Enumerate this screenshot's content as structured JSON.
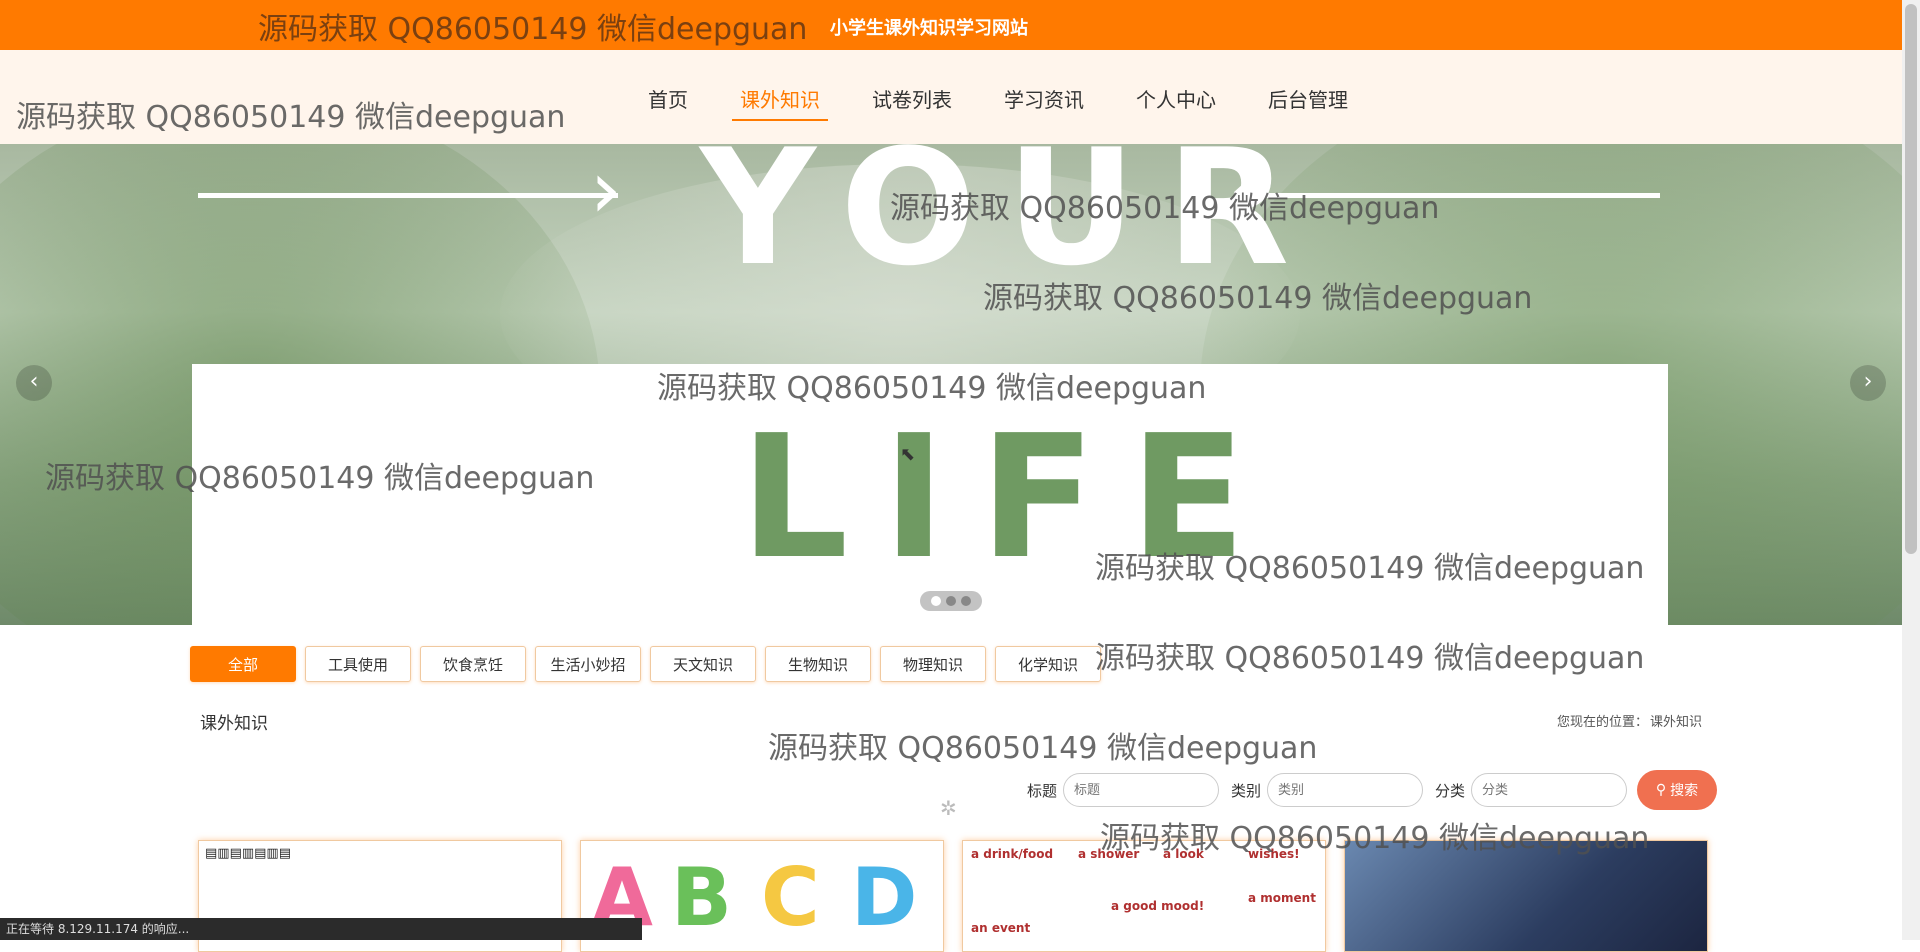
{
  "site_title": "小学生课外知识学习网站",
  "watermark_text": "源码获取 QQ86050149 微信deepguan",
  "nav": {
    "items": [
      {
        "label": "首页"
      },
      {
        "label": "课外知识"
      },
      {
        "label": "试卷列表"
      },
      {
        "label": "学习资讯"
      },
      {
        "label": "个人中心"
      },
      {
        "label": "后台管理"
      }
    ],
    "active_index": 1
  },
  "banner": {
    "word_top": "YOUR",
    "word_bottom": "LIFE",
    "prev_label": "‹",
    "next_label": "›",
    "slide_count": 3,
    "active_slide": 1
  },
  "categories": {
    "items": [
      {
        "label": "全部"
      },
      {
        "label": "工具使用"
      },
      {
        "label": "饮食烹饪"
      },
      {
        "label": "生活小妙招"
      },
      {
        "label": "天文知识"
      },
      {
        "label": "生物知识"
      },
      {
        "label": "物理知识"
      },
      {
        "label": "化学知识"
      }
    ],
    "active_index": 0
  },
  "section": {
    "title": "课外知识",
    "breadcrumb_prefix": "您现在的位置：",
    "breadcrumb_current": "课外知识"
  },
  "search": {
    "title_label": "标题",
    "title_placeholder": "标题",
    "type_label": "类别",
    "type_placeholder": "类别",
    "category_label": "分类",
    "category_placeholder": "分类",
    "button_label": "搜索"
  },
  "cards": {
    "card2_letters": [
      "A",
      "B",
      "C",
      "D"
    ],
    "card3_headings": [
      "a drink/food",
      "a shower",
      "a look",
      "wishes!",
      "a good mood!",
      "an event",
      "a moment"
    ]
  },
  "status_text": "正在等待 8.129.11.174 的响应...",
  "colors": {
    "accent": "#ff7a00",
    "nav_bg": "#fff5ec",
    "search_button": "#f07050"
  }
}
